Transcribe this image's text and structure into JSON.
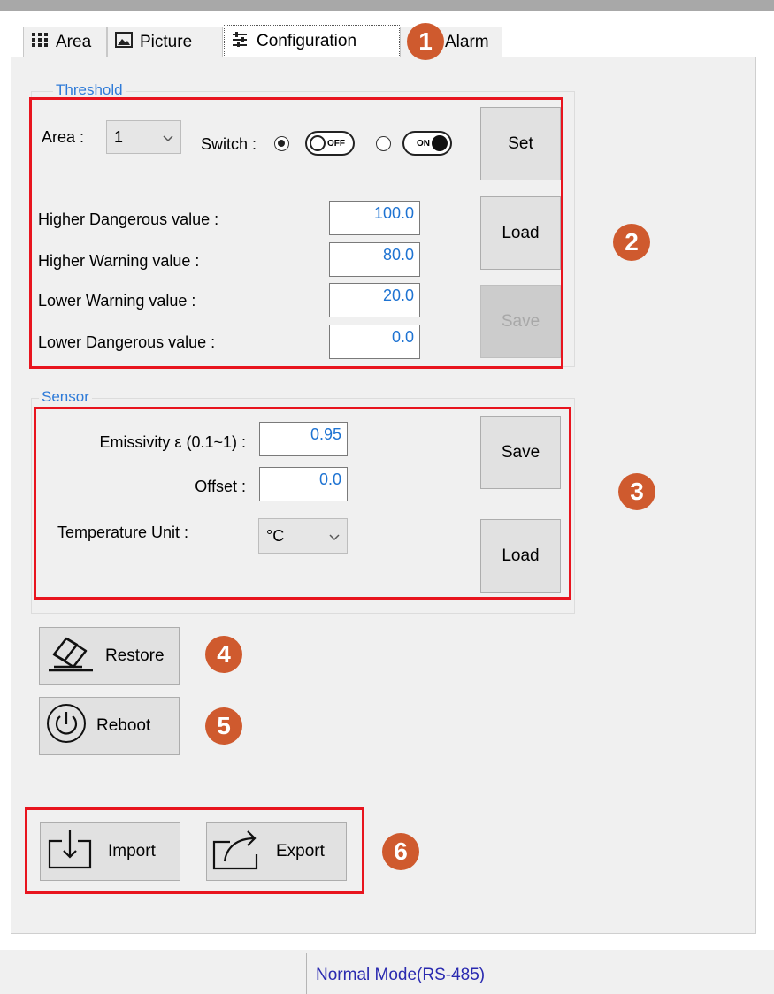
{
  "tabs": [
    {
      "label": "Area",
      "icon": "grid-icon"
    },
    {
      "label": "Picture",
      "icon": "picture-icon"
    },
    {
      "label": "Configuration",
      "icon": "sliders-icon"
    },
    {
      "label": "Alarm",
      "icon": ""
    }
  ],
  "threshold": {
    "legend": "Threshold",
    "area_label": "Area :",
    "area_value": "1",
    "switch_label": "Switch :",
    "switch_off": "OFF",
    "switch_on": "ON",
    "switch_selected": "OFF",
    "set_label": "Set",
    "load_label": "Load",
    "save_label": "Save",
    "fields": [
      {
        "label": "Higher Dangerous value :",
        "value": "100.0"
      },
      {
        "label": "Higher Warning value :",
        "value": "80.0"
      },
      {
        "label": "Lower Warning value :",
        "value": "20.0"
      },
      {
        "label": "Lower Dangerous value :",
        "value": "0.0"
      }
    ]
  },
  "sensor": {
    "legend": "Sensor",
    "emissivity_label": "Emissivity ε (0.1~1) :",
    "emissivity_value": "0.95",
    "offset_label": "Offset :",
    "offset_value": "0.0",
    "unit_label": "Temperature Unit :",
    "unit_value": "°C",
    "save_label": "Save",
    "load_label": "Load"
  },
  "actions": {
    "restore_label": "Restore",
    "reboot_label": "Reboot",
    "import_label": "Import",
    "export_label": "Export"
  },
  "badges": [
    "1",
    "2",
    "3",
    "4",
    "5",
    "6"
  ],
  "status": {
    "mode": "Normal Mode(RS-485)"
  },
  "colors": {
    "accent": "#2f7bd8",
    "highlight": "#e8141e",
    "badge": "#cf5a2e",
    "value_text": "#1e73d2"
  }
}
